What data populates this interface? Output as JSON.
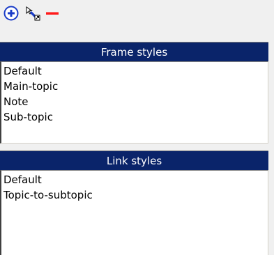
{
  "toolbar": {
    "add_icon": "plus-circle-icon",
    "connect_icon": "connect-arrows-icon",
    "remove_icon": "minus-icon",
    "colors": {
      "add": "#1a3cc8",
      "remove": "#ff1a1a"
    }
  },
  "frame_styles": {
    "header": "Frame styles",
    "items": [
      "Default",
      "Main-topic",
      "Note",
      "Sub-topic"
    ]
  },
  "link_styles": {
    "header": "Link styles",
    "items": [
      "Default",
      "Topic-to-subtopic"
    ]
  },
  "colors": {
    "header_bg": "#0a246a",
    "header_text": "#ffffff",
    "list_bg": "#ffffff",
    "window_bg": "#f0f0f0"
  }
}
